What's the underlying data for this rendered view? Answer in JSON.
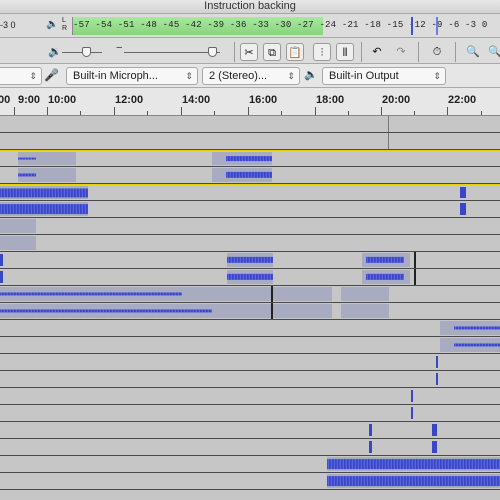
{
  "window": {
    "title": "Instruction backing"
  },
  "toolbar1": {
    "left_value": "-3 0",
    "meter_icon": "🔈",
    "lr": "L\nR",
    "meter_scale": "-57 -54 -51 -48 -45 -42 -39 -36 -33 -30 -27 -24 -21 -18 -15 -12  -9  -6  -3  0"
  },
  "toolbar2": {
    "sliders": [
      "input-volume",
      "output-volume"
    ],
    "buttons": [
      "cut-icon",
      "copy-icon",
      "paste-icon",
      "trim-icon",
      "silence-icon",
      "undo-icon",
      "redo-icon",
      "timer-icon",
      "zoom-in-icon",
      "zoom-out-icon"
    ]
  },
  "toolbar3": {
    "host_value": "",
    "input_device": "Built-in Microph...",
    "channels": "2 (Stereo)...",
    "output_device": "Built-in Output"
  },
  "ruler": {
    "labels": [
      "00",
      "9:00",
      "10:00",
      "12:00",
      "14:00",
      "16:00",
      "18:00",
      "20:00",
      "22:00"
    ]
  },
  "colors": {
    "waveform": "#3f4fd0",
    "clip": "#a9abc0",
    "track": "#c6c6c6",
    "meter_green": "#88d47c",
    "selection": "#e3d200"
  }
}
